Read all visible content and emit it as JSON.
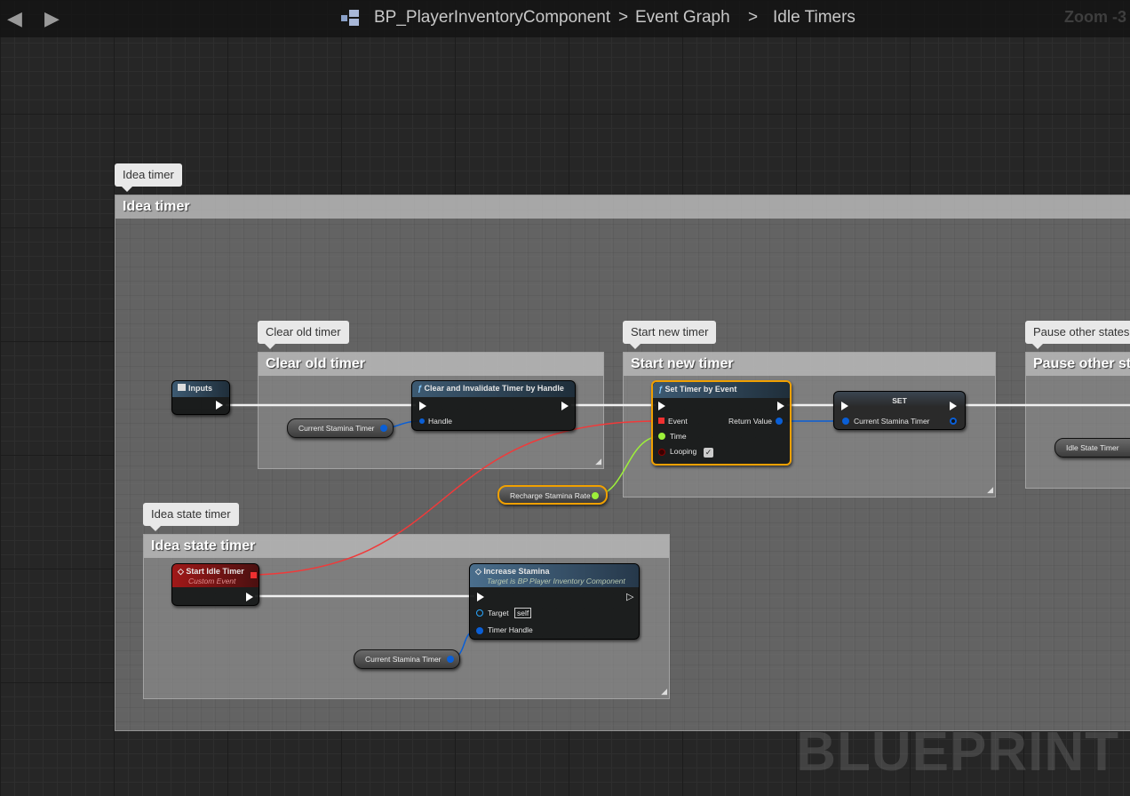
{
  "toolbar": {
    "back_icon": "arrow-left-icon",
    "forward_icon": "arrow-right-icon",
    "blueprint_name": "BP_PlayerInventoryComponent",
    "crumb_sep": ">",
    "graph": "Event Graph",
    "subgraph": "Idle Timers",
    "zoom": "Zoom -3"
  },
  "comments": {
    "idea_timer": "Idea timer",
    "clear_old": "Clear old timer",
    "start_new": "Start new timer",
    "pause_other": "Pause other states",
    "idea_state": "Idea state timer"
  },
  "nodes": {
    "inputs": {
      "title": "Inputs"
    },
    "clear": {
      "title": "Clear and Invalidate Timer by Handle",
      "handle": "Handle"
    },
    "set_timer": {
      "title": "Set Timer by Event",
      "event": "Event",
      "time": "Time",
      "looping": "Looping",
      "return": "Return Value",
      "looping_checked": true
    },
    "set": {
      "title": "SET",
      "var": "Current Stamina Timer"
    },
    "start_idle": {
      "title": "Start Idle Timer",
      "subtitle": "Custom Event"
    },
    "increase": {
      "title": "Increase Stamina",
      "subtitle": "Target is BP Player Inventory Component",
      "target": "Target",
      "self": "self",
      "timer_handle": "Timer Handle"
    },
    "var_current1": "Current Stamina Timer",
    "var_current2": "Current Stamina Timer",
    "var_recharge": "Recharge Stamina Rate",
    "var_idle": "Idle State Timer"
  },
  "colors": {
    "exec": "#ffffff",
    "struct_pin": "#0a5fd6",
    "float_pin": "#9df03a",
    "delegate_pin": "#f03030",
    "bool_pin": "#8c0000",
    "selected": "#f0a000"
  },
  "watermark": "BLUEPRINT"
}
